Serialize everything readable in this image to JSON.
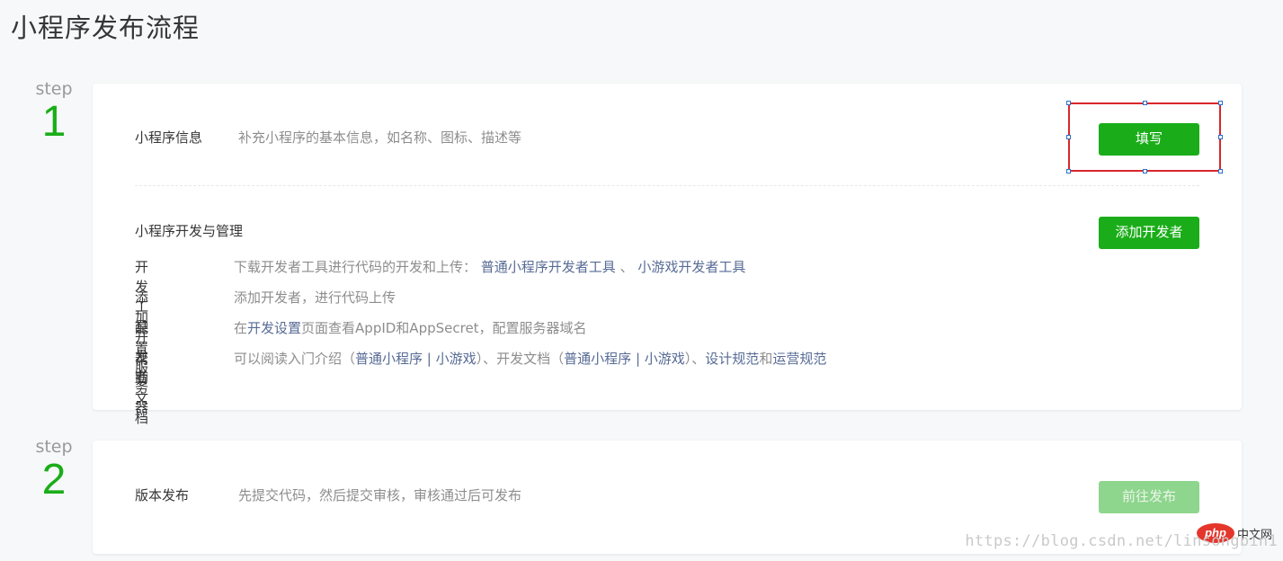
{
  "page": {
    "title": "小程序发布流程"
  },
  "steps": [
    {
      "word": "step",
      "number": "1"
    },
    {
      "word": "step",
      "number": "2"
    }
  ],
  "step1": {
    "info": {
      "title": "小程序信息",
      "desc": "补充小程序的基本信息，如名称、图标、描述等",
      "button": "填写"
    },
    "dev": {
      "title": "小程序开发与管理",
      "button": "添加开发者",
      "rows": [
        {
          "key": "开发工具",
          "text": "下载开发者工具进行代码的开发和上传：",
          "link1": "普通小程序开发者工具",
          "sep": "、",
          "link2": "小游戏开发者工具"
        },
        {
          "key": "添加开发者",
          "text": "添加开发者，进行代码上传"
        },
        {
          "key": "配置服务器",
          "pre": "在",
          "link": "开发设置",
          "post": "页面查看AppID和AppSecret，配置服务器域名"
        },
        {
          "key": "帮助文档",
          "t1": "可以阅读入门介绍（",
          "l1": "普通小程序",
          "t2": " | ",
          "l2": "小游戏",
          "t3": "）、开发文档（",
          "l3": "普通小程序",
          "t4": " | ",
          "l4": "小游戏",
          "t5": "）、",
          "l5": "设计规范",
          "t6": "和",
          "l6": "运营规范"
        }
      ]
    }
  },
  "step2": {
    "title": "版本发布",
    "desc": "先提交代码，然后提交审核，审核通过后可发布",
    "button": "前往发布"
  },
  "watermark": {
    "url": "https://blog.csdn.net/linsongbin1",
    "logo": "php",
    "site": "中文网"
  },
  "colors": {
    "accent": "#1aad19",
    "link": "#576b95",
    "selection": "#d8272c"
  }
}
